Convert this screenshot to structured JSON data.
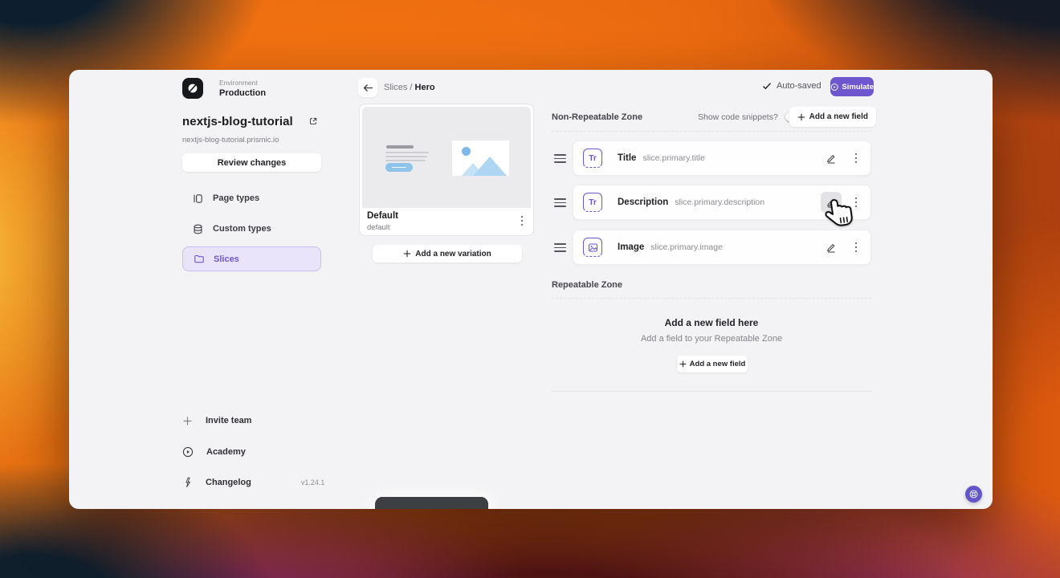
{
  "app": {
    "colors": {
      "accent": "#6E56CF",
      "accent_light_bg": "#E9E4FA",
      "accent_border": "#C9BDF1",
      "window_bg": "#F3F3F5",
      "toast_bg": "#3D4043",
      "preview_blue": "#8FC3EA"
    },
    "sidebar": {
      "environment_label": "Environment",
      "environment_name": "Production",
      "repo_name": "nextjs-blog-tutorial",
      "repo_url": "nextjs-blog-tutorial.prismic.io",
      "review_changes": "Review changes",
      "nav": [
        {
          "label": "Page types",
          "active": false
        },
        {
          "label": "Custom types",
          "active": false
        },
        {
          "label": "Slices",
          "active": true
        }
      ],
      "footer": [
        {
          "label": "Invite team"
        },
        {
          "label": "Academy"
        },
        {
          "label": "Changelog",
          "version": "v1.24.1"
        }
      ]
    },
    "header": {
      "breadcrumb_parent": "Slices",
      "breadcrumb_divider": "/",
      "breadcrumb_current": "Hero",
      "autosave_status": "Auto-saved",
      "simulate_button": "Simulate"
    },
    "variation": {
      "name": "Default",
      "id": "default",
      "add_button": "Add a new variation"
    },
    "non_repeatable_zone": {
      "title": "Non-Repeatable Zone",
      "toggle_label": "Show code snippets?",
      "toggle_on": false,
      "add_field_button": "Add a new field",
      "fields": [
        {
          "badge": "Tr",
          "type": "rich-text",
          "label": "Title",
          "api_id": "slice.primary.title"
        },
        {
          "badge": "Tr",
          "type": "rich-text",
          "label": "Description",
          "api_id": "slice.primary.description"
        },
        {
          "badge": "",
          "type": "image",
          "label": "Image",
          "api_id": "slice.primary.image"
        }
      ]
    },
    "repeatable_zone": {
      "title": "Repeatable Zone",
      "empty_title": "Add a new field here",
      "empty_subtitle": "Add a field to your Repeatable Zone",
      "add_field_button": "Add a new field"
    }
  }
}
